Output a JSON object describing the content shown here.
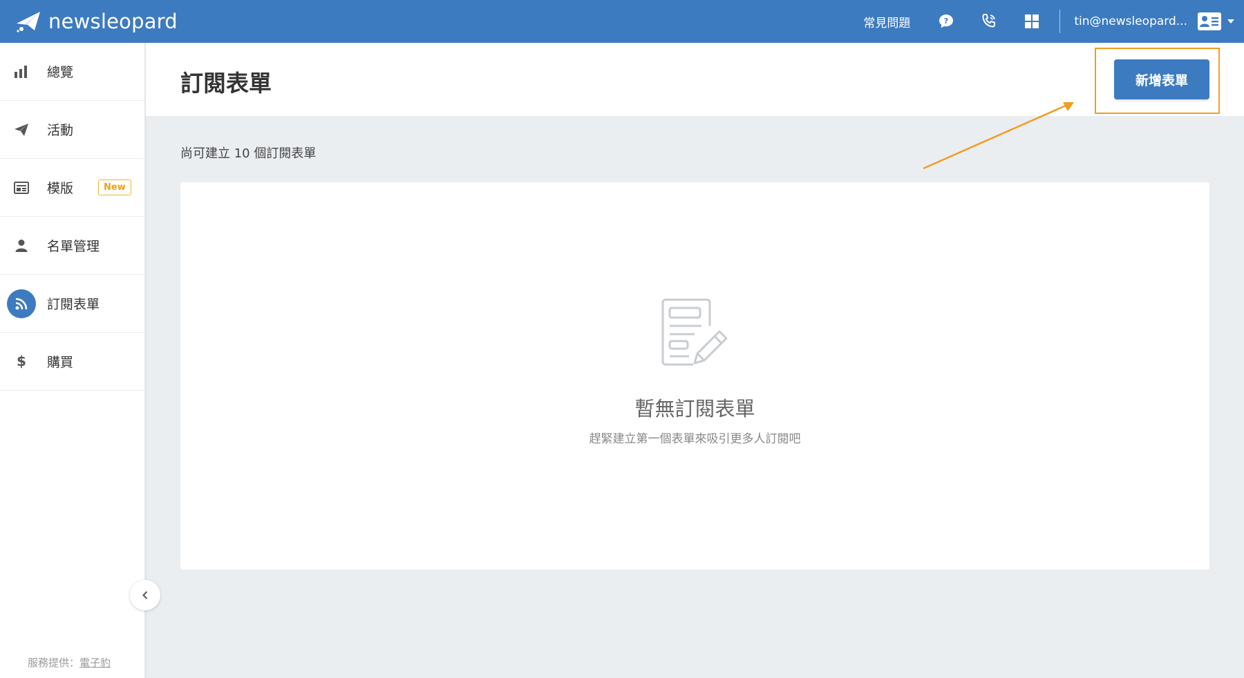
{
  "brand": {
    "name": "newsleopard"
  },
  "topbar": {
    "faq_label": "常見問題",
    "icons": [
      "chat-question-icon",
      "phone-icon",
      "apps-grid-icon"
    ],
    "user_email": "tin@newsleopard...",
    "user_card_icon": "contact-card-icon"
  },
  "sidebar": {
    "items": [
      {
        "label": "總覽",
        "icon": "bar-chart-icon",
        "active": false
      },
      {
        "label": "活動",
        "icon": "paper-plane-icon",
        "active": false
      },
      {
        "label": "模版",
        "icon": "template-icon",
        "active": false,
        "badge": "New"
      },
      {
        "label": "名單管理",
        "icon": "person-icon",
        "active": false
      },
      {
        "label": "訂閱表單",
        "icon": "rss-icon",
        "active": true
      },
      {
        "label": "購買",
        "icon": "dollar-icon",
        "active": false
      }
    ],
    "footer_prefix": "服務提供：",
    "footer_link": "電子豹"
  },
  "page": {
    "title": "訂閱表單",
    "new_button_label": "新增表單",
    "remaining_text": "尚可建立 10 個訂閱表單",
    "empty_title": "暫無訂閱表單",
    "empty_subtitle": "趕緊建立第一個表單來吸引更多人訂閱吧"
  },
  "colors": {
    "primary": "#3d7bc0",
    "highlight": "#f29c1f",
    "badge": "#f0b429",
    "background": "#ebeef1"
  }
}
